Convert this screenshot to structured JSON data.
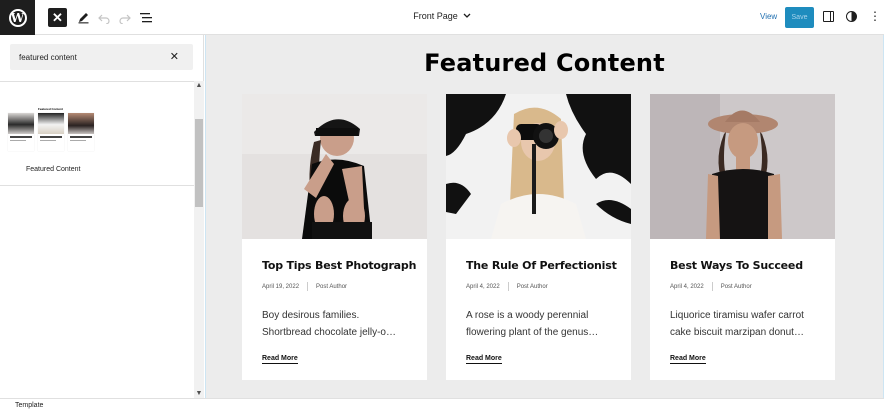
{
  "toolbar": {
    "logo_icon": "wordpress-logo-icon",
    "close_icon": "close-icon",
    "close_glyph": "✕",
    "tools_icon": "pencil-icon",
    "undo_icon": "undo-icon",
    "redo_icon": "redo-icon",
    "list_view_icon": "list-view-icon",
    "document_title": "Front Page",
    "view_label": "View",
    "save_label": "Save",
    "settings_icon": "sidebar-toggle-icon",
    "styles_icon": "half-circle-icon",
    "options_icon": "more-vertical-icon"
  },
  "inserter": {
    "search_value": "featured content",
    "clear_glyph": "✕",
    "pattern_preview_title": "Featured Content",
    "pattern_label": "Featured Content"
  },
  "canvas": {
    "heading": "Featured Content",
    "posts": [
      {
        "title": "Top Tips Best Photograph",
        "date": "April 19, 2022",
        "author": "Post Author",
        "excerpt_line1": "Boy desirous families.",
        "excerpt_line2": "Shortbread chocolate jelly-o…",
        "read_more": "Read More"
      },
      {
        "title": "The Rule Of Perfectionist",
        "date": "April 4, 2022",
        "author": "Post Author",
        "excerpt_line1": "A rose is a woody perennial",
        "excerpt_line2": "flowering plant of the genus…",
        "read_more": "Read More"
      },
      {
        "title": "Best Ways To Succeed",
        "date": "April 4, 2022",
        "author": "Post Author",
        "excerpt_line1": "Liquorice tiramisu wafer carrot",
        "excerpt_line2": "cake biscuit marzipan donut…",
        "read_more": "Read More"
      }
    ]
  },
  "statusbar": {
    "breadcrumb": "Template"
  },
  "colors": {
    "accent": "#2271b1",
    "save_bg": "#1e8cbe",
    "canvas_bg": "#ececec",
    "dark": "#1e1e1e"
  }
}
